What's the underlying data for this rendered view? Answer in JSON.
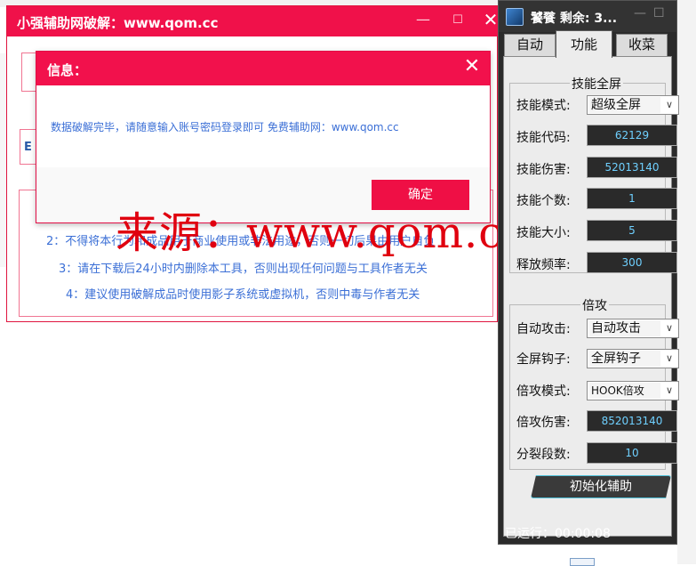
{
  "main_window": {
    "title": "小强辅助网破解：www.qom.cc",
    "panel_char": "E",
    "notices": [
      "2：不得将本行为和成品用于商业使用或非法用途，否则一切后果由用户自负",
      "3：请在下载后24小时内删除本工具，否则出现任何问题与工具作者无关",
      "4：建议使用破解成品时使用影子系统或虚拟机，否则中毒与作者无关"
    ]
  },
  "info_dialog": {
    "title": "信息：",
    "message": "数据破解完毕，请随意输入账号密码登录即可 免费辅助网：www.qom.cc",
    "ok_label": "确定",
    "close_glyph": "✕"
  },
  "watermark": "来源：www.qom.cc",
  "tool": {
    "title": "饕餮  剩余: 3...",
    "tabs": [
      "自动",
      "功能",
      "收菜"
    ],
    "active_tab": "功能",
    "skill_group": {
      "title": "技能全屏",
      "rows": [
        {
          "label": "技能模式:",
          "type": "select",
          "value": "超级全屏"
        },
        {
          "label": "技能代码:",
          "type": "input",
          "value": "62129"
        },
        {
          "label": "技能伤害:",
          "type": "input",
          "value": "52013140"
        },
        {
          "label": "技能个数:",
          "type": "input",
          "value": "1"
        },
        {
          "label": "技能大小:",
          "type": "input",
          "value": "5"
        },
        {
          "label": "释放频率:",
          "type": "input",
          "value": "300"
        }
      ]
    },
    "attack_group": {
      "title": "倍攻",
      "rows": [
        {
          "label": "自动攻击:",
          "type": "select",
          "value": "自动攻击"
        },
        {
          "label": "全屏钩子:",
          "type": "select",
          "value": "全屏钩子"
        },
        {
          "label": "倍攻模式:",
          "type": "select",
          "value": "HOOK倍攻"
        },
        {
          "label": "倍攻伤害:",
          "type": "input",
          "value": "852013140"
        },
        {
          "label": "分裂段数:",
          "type": "input",
          "value": "10"
        }
      ]
    },
    "init_button": "初始化辅助",
    "status": "已运行：00:00:08",
    "arrow_glyph": "∨",
    "min_glyph": "—",
    "max_glyph": "☐"
  },
  "colors": {
    "accent_pink": "#f0114a",
    "link_blue": "#3b6fd6",
    "value_cyan": "#6fd0ff",
    "panel_dark": "#2b2b2b"
  }
}
